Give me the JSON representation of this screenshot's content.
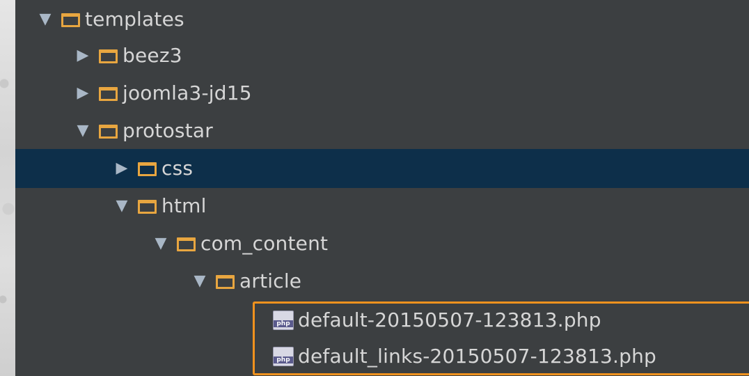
{
  "tree": {
    "nodes": [
      {
        "label": "templates",
        "arrow": "▼"
      },
      {
        "label": "beez3",
        "arrow": "▶"
      },
      {
        "label": "joomla3-jd15",
        "arrow": "▶"
      },
      {
        "label": "protostar",
        "arrow": "▼"
      },
      {
        "label": "css",
        "arrow": "▶"
      },
      {
        "label": "html",
        "arrow": "▼"
      },
      {
        "label": "com_content",
        "arrow": "▼"
      },
      {
        "label": "article",
        "arrow": "▼"
      },
      {
        "label": "default-20150507-123813.php",
        "icon_text": "php"
      },
      {
        "label": "default_links-20150507-123813.php",
        "icon_text": "php"
      }
    ]
  },
  "colors": {
    "panel_background": "#3c3f41",
    "selected_row": "#0d2f4a",
    "folder_icon": "#e8a640",
    "highlight_border": "#f0921e",
    "text": "#d6d6d6"
  },
  "icons": {
    "expanded": "triangle-down-icon",
    "collapsed": "triangle-right-icon",
    "folder": "folder-icon",
    "file": "php-file-icon"
  }
}
